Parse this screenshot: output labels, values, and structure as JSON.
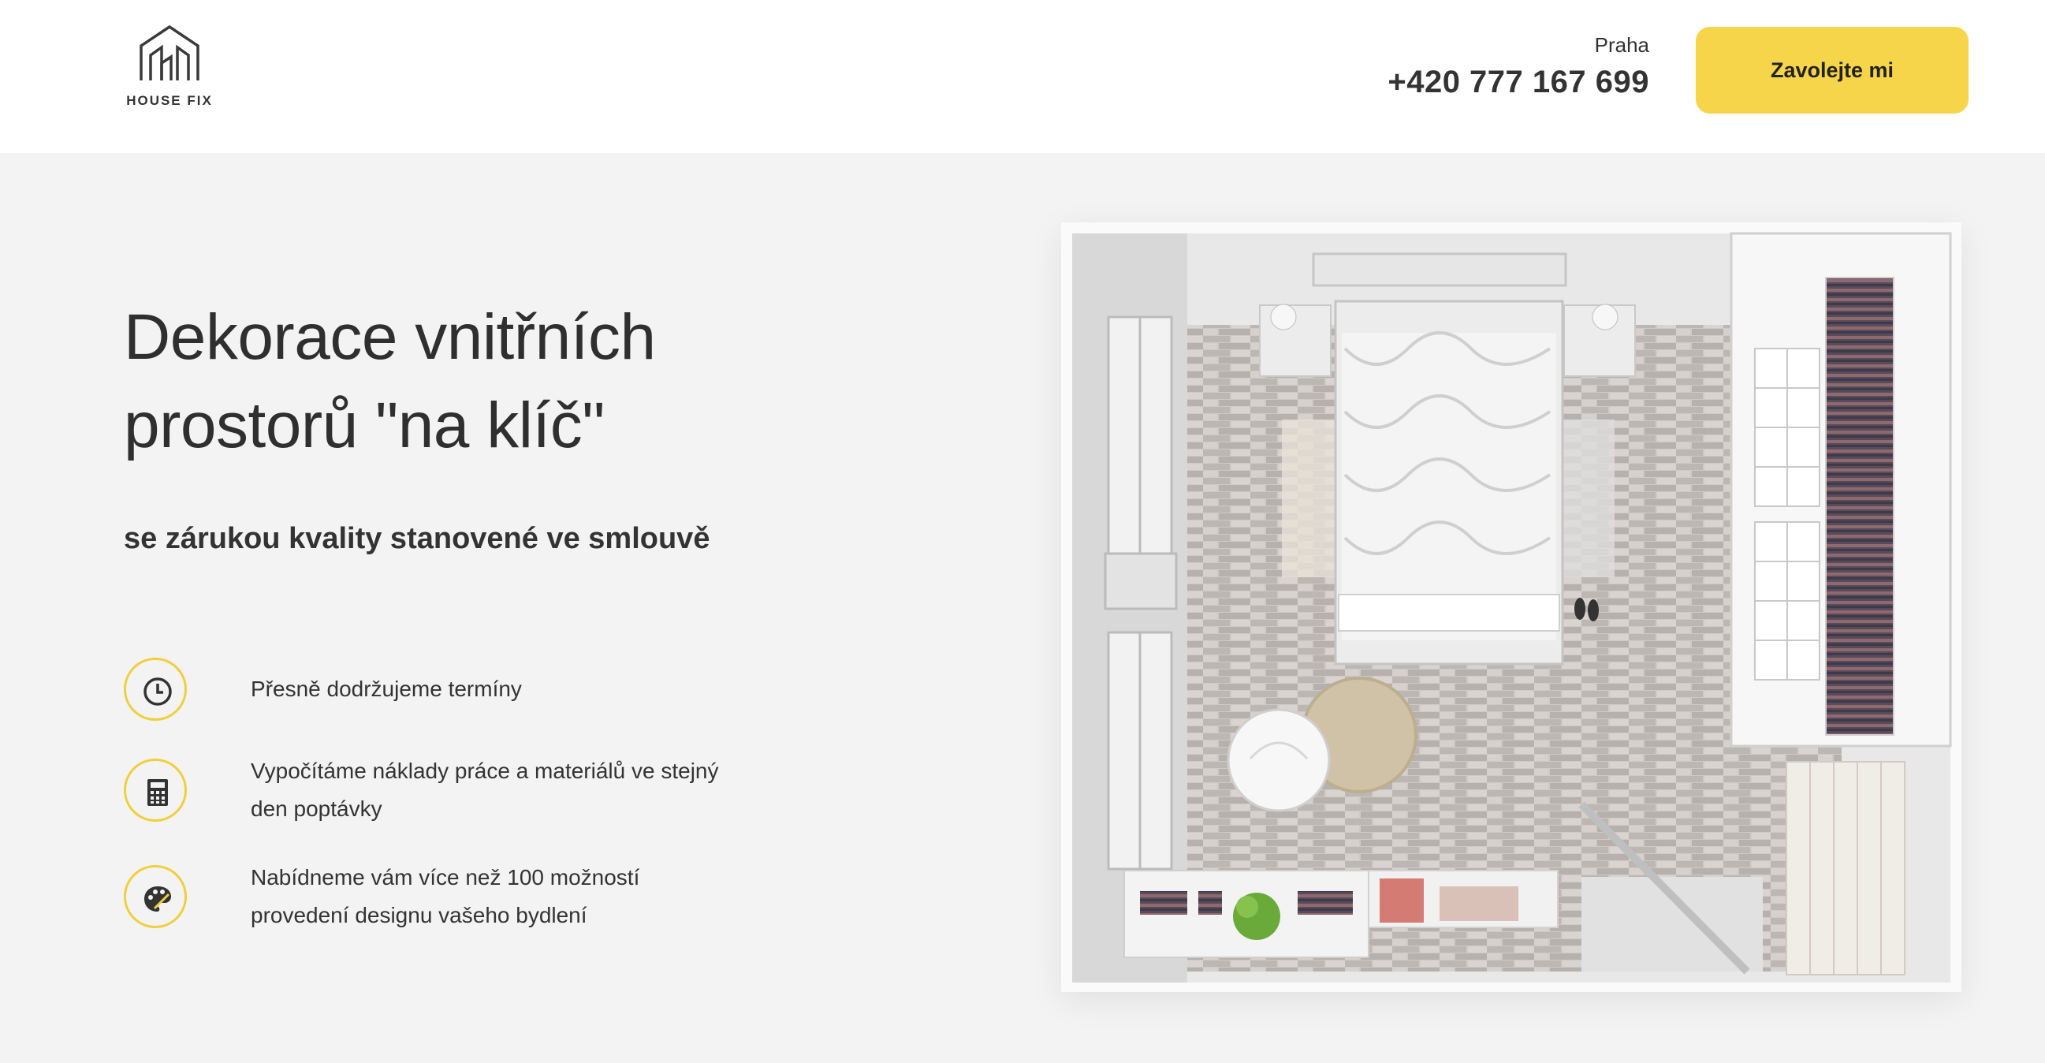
{
  "brand": {
    "name": "HOUSE FIX"
  },
  "header": {
    "city": "Praha",
    "phone": "+420 777 167 699",
    "cta_label": "Zavolejte mi"
  },
  "hero": {
    "title_line1": "Dekorace vnitřních",
    "title_line2": "prostorů \"na klíč\"",
    "subtitle": "se zárukou kvality stanovené ve smlouvě",
    "features": [
      {
        "icon": "clock-icon",
        "line1": "Přesně dodržujeme termíny",
        "line2": ""
      },
      {
        "icon": "calculator-icon",
        "line1": "Vypočítáme náklady práce a materiálů ve stejný",
        "line2": "den poptávky"
      },
      {
        "icon": "palette-icon",
        "line1": "Nabídneme vám více než 100 možností",
        "line2": "provedení designu vašeho bydlení"
      }
    ]
  },
  "colors": {
    "accent": "#f7d54a",
    "text": "#333333",
    "background": "#f3f3f3"
  }
}
